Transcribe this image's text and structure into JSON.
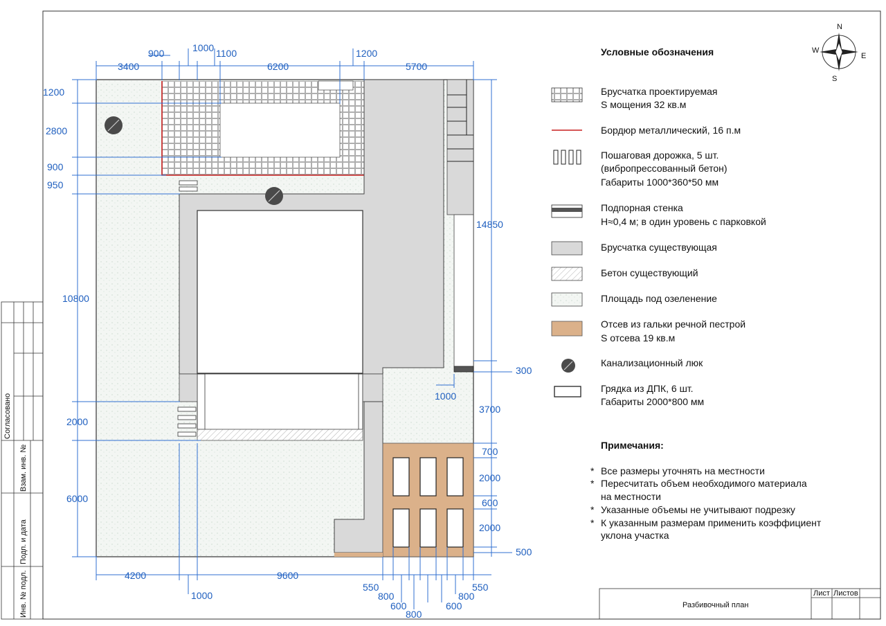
{
  "legend": {
    "title": "Условные  обозначения",
    "items": [
      {
        "line1": "Брусчатка проектируемая",
        "line2": "S мощения 32 кв.м"
      },
      {
        "line1": "Бордюр металлический, 16 п.м"
      },
      {
        "line1": "Пошаговая дорожка, 5 шт.",
        "line2": "(вибропрессованный бетон)",
        "line3": "Габариты 1000*360*50 мм"
      },
      {
        "line1": "Подпорная стенка",
        "line2": "Н≈0,4 м; в один уровень с парковкой"
      },
      {
        "line1": "Брусчатка существующая"
      },
      {
        "line1": "Бетон существующий"
      },
      {
        "line1": "Площадь под озеленение"
      },
      {
        "line1": "Отсев из гальки речной пестрой",
        "line2": "S отсева  19 кв.м"
      },
      {
        "line1": "Канализационный люк"
      },
      {
        "line1": "Грядка из ДПК, 6 шт.",
        "line2": "Габариты 2000*800 мм"
      }
    ]
  },
  "notes": {
    "title": "Примечания:",
    "items": [
      {
        "line1": "Все размеры уточнять на местности"
      },
      {
        "line1": "Пересчитать объем необходимого материала",
        "line2": "на местности"
      },
      {
        "line1": "Указанные объемы не учитывают подрезку"
      },
      {
        "line1": "К указанным размерам применить коэффициент",
        "line2": "уклона участка"
      }
    ]
  },
  "compass": {
    "n": "N",
    "s": "S",
    "e": "E",
    "w": "W"
  },
  "stamp": {
    "sheet_title": "Разбивочный план",
    "sheet_label": "Лист",
    "sheets_label": "Листов"
  },
  "side_labels": {
    "agreed": "Согласовано",
    "replace": "Взам. инв. №",
    "sign_date": "Подп. и дата",
    "inv_orig": "Инв. № подл."
  },
  "dims": {
    "top": [
      "3400",
      "900",
      "1000",
      "1100",
      "6200",
      "1200",
      "5700"
    ],
    "left": [
      "1200",
      "2800",
      "900",
      "950",
      "10800",
      "2000",
      "6000"
    ],
    "right": [
      "14850",
      "300",
      "1000",
      "3700",
      "700",
      "2000",
      "600",
      "2000",
      "500"
    ],
    "bottom": [
      "4200",
      "1000",
      "9600",
      "550",
      "800",
      "600",
      "800",
      "600",
      "800",
      "550"
    ]
  },
  "colors": {
    "existing_paving": "#d9d9d9",
    "gravel": "#dbb18a",
    "border": "#c81e1e",
    "dimension": "#1f5fbf",
    "greenery": "#eef3ef"
  }
}
